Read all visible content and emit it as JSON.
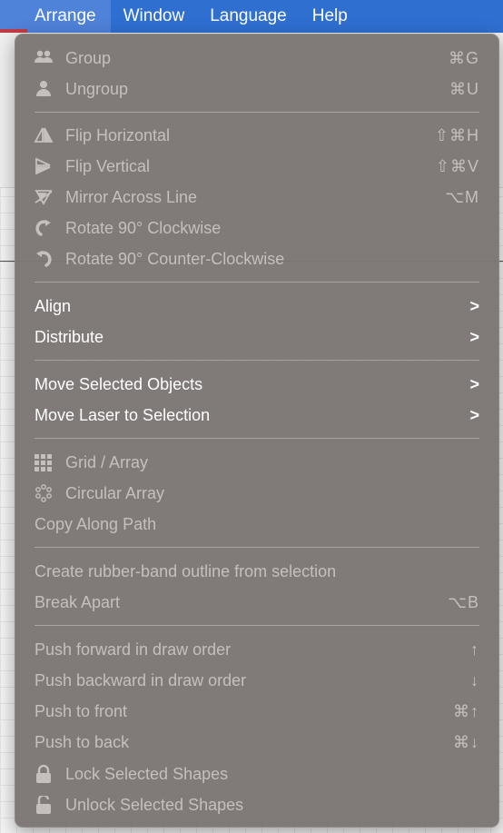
{
  "menubar": {
    "items": [
      {
        "label": "Arrange"
      },
      {
        "label": "Window"
      },
      {
        "label": "Language"
      },
      {
        "label": "Help"
      }
    ]
  },
  "menu": {
    "group": {
      "label": "Group",
      "shortcut": "⌘G",
      "icon": "group-icon"
    },
    "ungroup": {
      "label": "Ungroup",
      "shortcut": "⌘U",
      "icon": "ungroup-icon"
    },
    "flip_h": {
      "label": "Flip Horizontal",
      "shortcut": "⇧⌘H",
      "icon": "flip-horizontal-icon"
    },
    "flip_v": {
      "label": "Flip Vertical",
      "shortcut": "⇧⌘V",
      "icon": "flip-vertical-icon"
    },
    "mirror": {
      "label": "Mirror Across Line",
      "shortcut": "⌥M",
      "icon": "mirror-icon"
    },
    "rot_cw": {
      "label": "Rotate 90° Clockwise",
      "icon": "rotate-cw-icon"
    },
    "rot_ccw": {
      "label": "Rotate 90° Counter-Clockwise",
      "icon": "rotate-ccw-icon"
    },
    "align": {
      "label": "Align",
      "chevron": ">"
    },
    "distribute": {
      "label": "Distribute",
      "chevron": ">"
    },
    "move_sel": {
      "label": "Move Selected Objects",
      "chevron": ">"
    },
    "move_laser": {
      "label": "Move Laser to Selection",
      "chevron": ">"
    },
    "grid": {
      "label": "Grid / Array",
      "icon": "grid-icon"
    },
    "circular": {
      "label": "Circular Array",
      "icon": "circular-array-icon"
    },
    "copy_path": {
      "label": "Copy Along Path"
    },
    "rubber": {
      "label": "Create rubber-band outline from selection"
    },
    "break_apart": {
      "label": "Break Apart",
      "shortcut": "⌥B"
    },
    "push_fwd": {
      "label": "Push forward in draw order",
      "shortcut": "↑"
    },
    "push_back": {
      "label": "Push backward in draw order",
      "shortcut": "↓"
    },
    "push_front": {
      "label": "Push to front",
      "shortcut": "⌘↑"
    },
    "push_to_back": {
      "label": "Push to back",
      "shortcut": "⌘↓"
    },
    "lock": {
      "label": "Lock Selected Shapes",
      "icon": "lock-icon"
    },
    "unlock": {
      "label": "Unlock Selected Shapes",
      "icon": "unlock-icon"
    }
  },
  "colors": {
    "menubar": "#2f6fd0",
    "menu_bg": "#7c7674",
    "enabled_text": "#ffffff",
    "disabled_text": "#c5c0bd"
  }
}
